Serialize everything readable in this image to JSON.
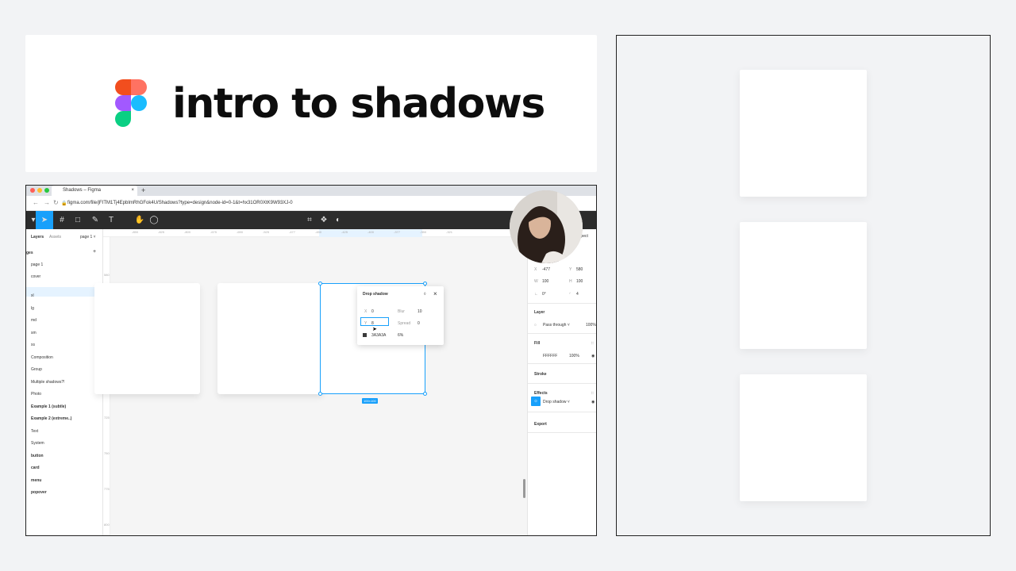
{
  "title": {
    "text": "intro to shadows"
  },
  "browser": {
    "tab_title": "Shadows – Figma",
    "tab_close": "×",
    "new_tab": "+",
    "url": "figma.com/file/jFITM1Tj4EpbImRhGFok4U/Shadows?type=design&node-id=0-1&t=hx31OR0XtK9W93XJ-0"
  },
  "figma": {
    "panel_tabs": {
      "layers": "Layers",
      "assets": "Assets",
      "page": "page 1 ˅"
    },
    "pages_header": "ges",
    "add": "+",
    "pages": [
      "page 1",
      "cover"
    ],
    "layers": [
      {
        "label": "xl",
        "bold": false
      },
      {
        "label": "lg",
        "bold": false
      },
      {
        "label": "md",
        "bold": false
      },
      {
        "label": "sm",
        "bold": false
      },
      {
        "label": "xs",
        "bold": false
      },
      {
        "label": "Composition",
        "bold": false
      },
      {
        "label": "Group",
        "bold": false
      },
      {
        "label": "Multiple shadows?!",
        "bold": false
      },
      {
        "label": "Photo",
        "bold": false
      },
      {
        "label": "Example 1 (subtle)",
        "bold": true
      },
      {
        "label": "Example 2 (extreme..)",
        "bold": true
      },
      {
        "label": "Text",
        "bold": false
      },
      {
        "label": "System",
        "bold": false
      },
      {
        "label": "button",
        "bold": true
      },
      {
        "label": "card",
        "bold": true
      },
      {
        "label": "menu",
        "bold": true
      },
      {
        "label": "popover",
        "bold": true
      }
    ],
    "ruler_ticks": [
      "-850",
      "-825",
      "-800",
      "-675",
      "-650",
      "-525",
      "-477",
      "-450",
      "-425",
      "-400",
      "-377",
      "-350",
      "-321"
    ],
    "vruler_ticks": [
      "580",
      "625",
      "650",
      "680",
      "725",
      "750",
      "775",
      "800"
    ],
    "size_label": "100×100",
    "drop_shadow_popup": {
      "title": "Drop shadow",
      "x_label": "X",
      "x_value": "0",
      "blur_label": "Blur",
      "blur_value": "10",
      "y_label": "Y",
      "y_value": "8",
      "spread_label": "Spread",
      "spread_value": "0",
      "color": "3A3A3A",
      "opacity": "6%",
      "close": "×"
    },
    "props": {
      "tab": "spect",
      "x_label": "X",
      "x_value": "-477",
      "y_label": "Y",
      "y_value": "580",
      "w_label": "W",
      "w_value": "100",
      "h_label": "H",
      "h_value": "100",
      "rot_label": "∟",
      "rot_value": "0°",
      "radius_label": "◜",
      "radius_value": "4",
      "layer_header": "Layer",
      "blend": "Pass through ˅",
      "layer_opacity": "100%",
      "fill_header": "Fill",
      "fill_hex": "FFFFFF",
      "fill_opacity": "100%",
      "stroke_header": "Stroke",
      "effects_header": "Effects",
      "effect_name": "Drop shadow ˅",
      "export_header": "Export"
    }
  },
  "colors": {
    "accent": "#18a0fb",
    "toolbar": "#2c2c2c",
    "shadow": "#3A3A3A"
  }
}
